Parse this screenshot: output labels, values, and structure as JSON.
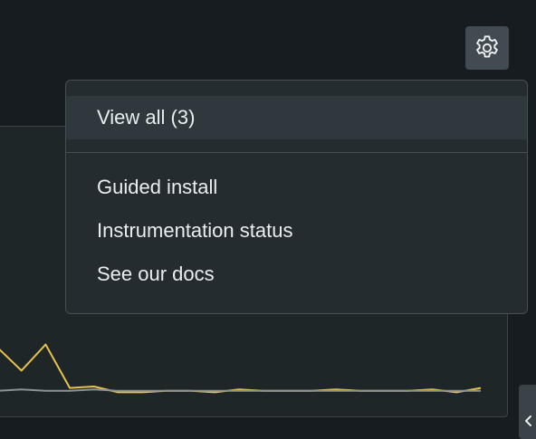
{
  "toolbar": {
    "settings_icon": "gear-icon"
  },
  "menu": {
    "primary_items": [
      {
        "label": "View all (3)"
      }
    ],
    "secondary_items": [
      {
        "label": "Guided install"
      },
      {
        "label": "Instrumentation status"
      },
      {
        "label": "See our docs"
      }
    ]
  },
  "side_panel": {
    "toggle_icon": "chevron-left-icon"
  },
  "chart_data": {
    "type": "line",
    "series": [
      {
        "color": "#e6c24a",
        "values": [
          3.2,
          1.6,
          3.4,
          0.4,
          0.5,
          0.1,
          0.1,
          0.2,
          0.2,
          0.1,
          0.3,
          0.2,
          0.2,
          0.2,
          0.3,
          0.2,
          0.2,
          0.2,
          0.3,
          0.1,
          0.4
        ]
      },
      {
        "color": "#8a9296",
        "values": [
          0.2,
          0.3,
          0.2,
          0.2,
          0.3,
          0.2,
          0.2,
          0.2,
          0.2,
          0.2,
          0.2,
          0.2,
          0.2,
          0.2,
          0.2,
          0.2,
          0.2,
          0.2,
          0.2,
          0.2,
          0.2
        ]
      }
    ],
    "colors": {
      "primary": "#e6c24a",
      "secondary": "#8a9296"
    }
  }
}
